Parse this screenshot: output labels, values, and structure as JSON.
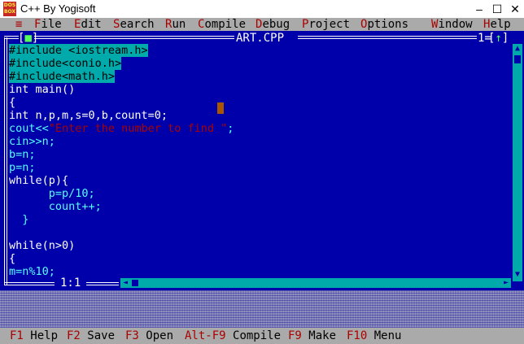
{
  "window": {
    "title": "C++ By Yogisoft",
    "icon_text": "DOS BOX",
    "minimize": "–",
    "maximize": "☐",
    "close": "✕"
  },
  "menu": {
    "system": "≡",
    "items": [
      {
        "hotkey": "F",
        "rest": "ile"
      },
      {
        "hotkey": "E",
        "rest": "dit"
      },
      {
        "hotkey": "S",
        "rest": "earch"
      },
      {
        "hotkey": "R",
        "rest": "un"
      },
      {
        "hotkey": "C",
        "rest": "ompile"
      },
      {
        "hotkey": "D",
        "rest": "ebug"
      },
      {
        "hotkey": "P",
        "rest": "roject"
      },
      {
        "hotkey": "O",
        "rest": "ptions"
      },
      {
        "hotkey": "W",
        "rest": "indow"
      },
      {
        "hotkey": "H",
        "rest": "elp"
      }
    ]
  },
  "editor": {
    "close_box_left": "[",
    "close_box_mark": "■",
    "close_box_right": "]",
    "file_title": "ART.CPP",
    "window_number": "1=",
    "zoom_left": "[",
    "zoom_mark": "↑",
    "zoom_right": "]",
    "cursor_position": "1:1",
    "code_lines": [
      "#include <iostream.h>",
      "#include<conio.h>",
      "#include<math.h>",
      "int main()",
      "{",
      "int n,p,m,s=0,b,count=0;",
      "cout<<\"Enter the number to find \";",
      "cin>>n;",
      "b=n;",
      "p=n;",
      "while(p){",
      "      p=p/10;",
      "      count++;",
      "  }",
      "",
      "while(n>0)",
      "{",
      "m=n%10;"
    ]
  },
  "scrollbars": {
    "up": "▲",
    "down": "▼",
    "left": "◄",
    "right": "►"
  },
  "statusbar": {
    "items": [
      {
        "key": "F1",
        "label": "Help"
      },
      {
        "key": "F2",
        "label": "Save"
      },
      {
        "key": "F3",
        "label": "Open"
      },
      {
        "key": "Alt-F9",
        "label": "Compile"
      },
      {
        "key": "F9",
        "label": "Make"
      },
      {
        "key": "F10",
        "label": "Menu"
      }
    ]
  },
  "colors": {
    "editor_bg": "#0000aa",
    "menu_bg": "#aaaaaa",
    "hotkey": "#aa0000",
    "selection": "#00aaaa",
    "cursor": "#aa5500"
  }
}
